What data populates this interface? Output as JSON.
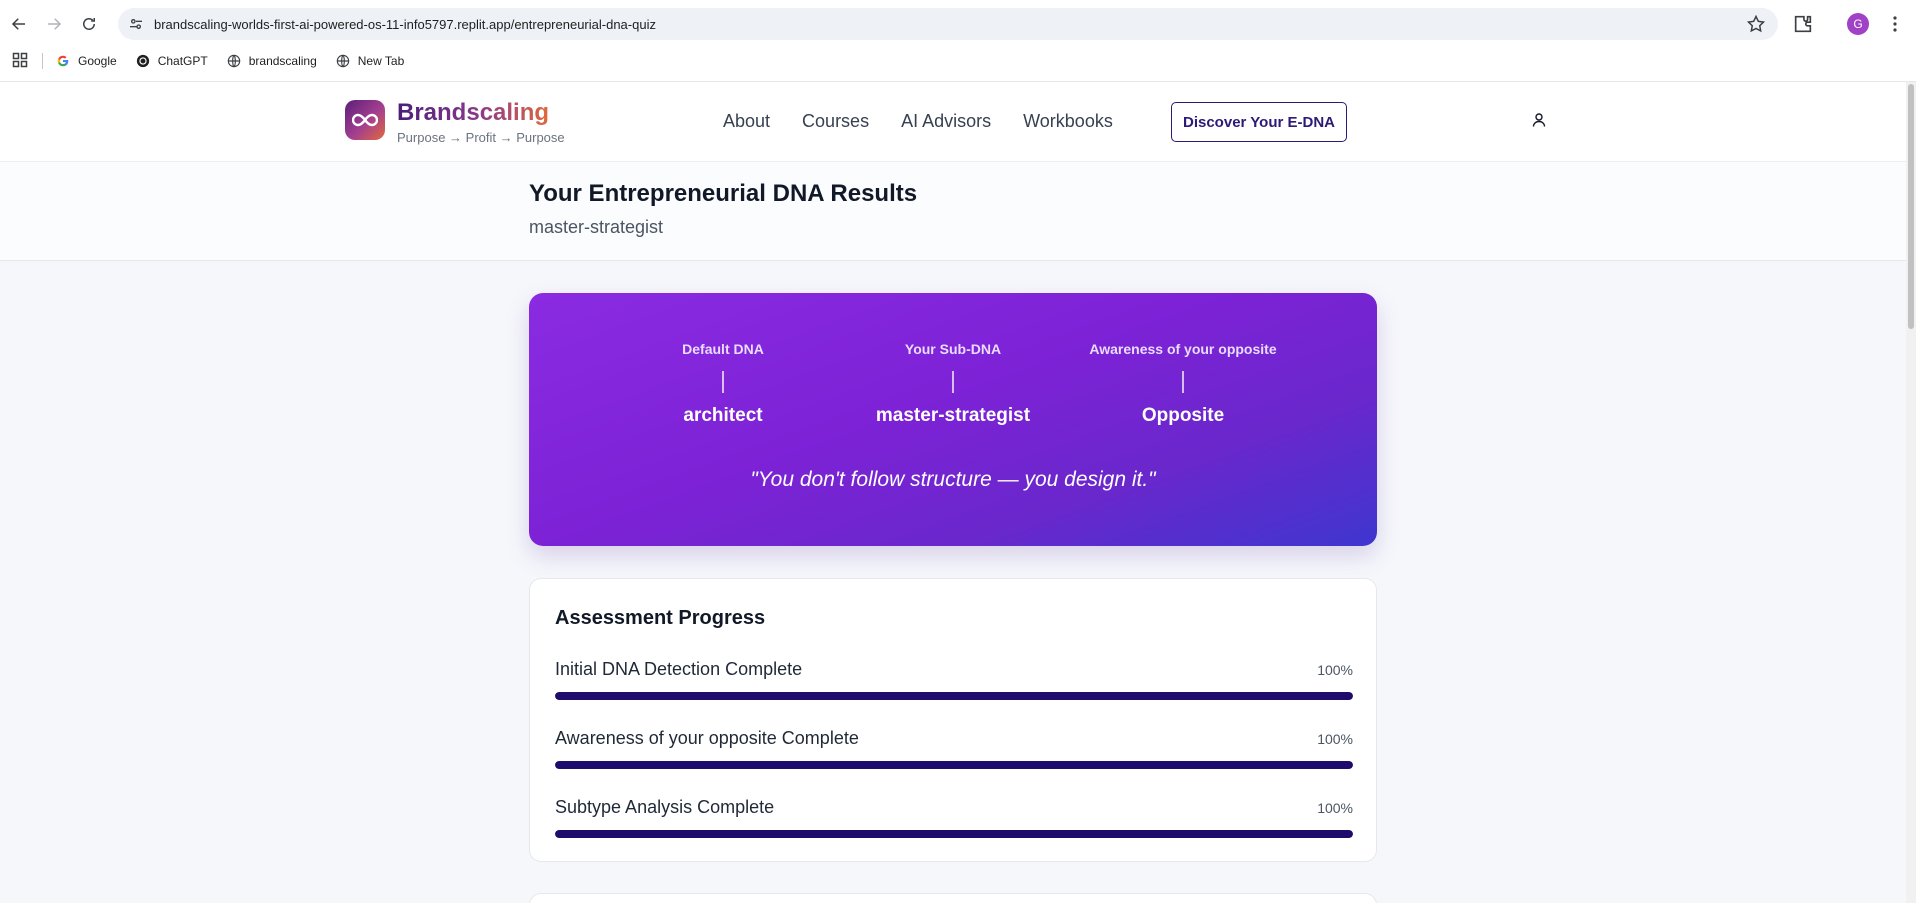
{
  "browser": {
    "url": "brandscaling-worlds-first-ai-powered-os-11-info5797.replit.app/entrepreneurial-dna-quiz",
    "profile_initial": "G",
    "bookmarks": [
      {
        "label": "Google",
        "icon": "google-icon"
      },
      {
        "label": "ChatGPT",
        "icon": "chatgpt-icon"
      },
      {
        "label": "brandscaling",
        "icon": "globe-icon"
      },
      {
        "label": "New Tab",
        "icon": "globe-icon"
      }
    ]
  },
  "header": {
    "brand_name": "Brandscaling",
    "tagline": "Purpose → Profit → Purpose",
    "nav": [
      "About",
      "Courses",
      "AI Advisors",
      "Workbooks"
    ],
    "cta_label": "Discover Your E-DNA",
    "logo_icon": "infinity-icon",
    "user_icon": "user-icon"
  },
  "page": {
    "title": "Your Entrepreneurial DNA Results",
    "subtitle": "master-strategist"
  },
  "dna_card": {
    "columns": [
      {
        "label": "Default DNA",
        "value": "architect"
      },
      {
        "label": "Your Sub-DNA",
        "value": "master-strategist"
      },
      {
        "label": "Awareness of your opposite",
        "value": "Opposite"
      }
    ],
    "quote": "\"You don't follow structure — you design it.\"",
    "gradient_colors": [
      "#8a2be2",
      "#3f36cf"
    ]
  },
  "progress": {
    "title": "Assessment Progress",
    "bar_color": "#1e0b6b",
    "items": [
      {
        "label": "Initial DNA Detection Complete",
        "percent_text": "100%",
        "percent": 100
      },
      {
        "label": "Awareness of your opposite Complete",
        "percent_text": "100%",
        "percent": 100
      },
      {
        "label": "Subtype Analysis Complete",
        "percent_text": "100%",
        "percent": 100
      }
    ]
  }
}
